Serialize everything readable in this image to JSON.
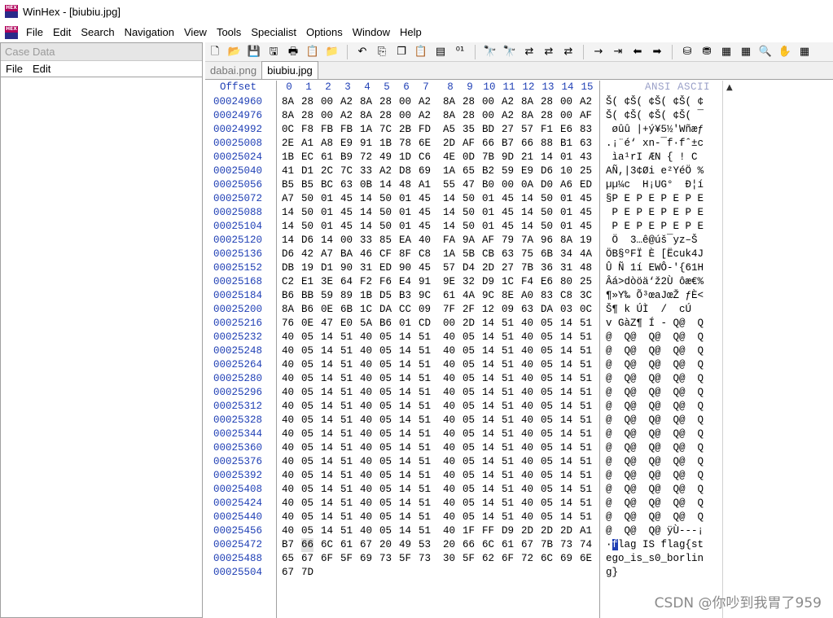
{
  "window": {
    "title": "WinHex - [biubiu.jpg]",
    "app_icon_text": "HEX"
  },
  "menu": [
    "File",
    "Edit",
    "Search",
    "Navigation",
    "View",
    "Tools",
    "Specialist",
    "Options",
    "Window",
    "Help"
  ],
  "case_panel": {
    "header": "Case Data",
    "menu": [
      "File",
      "Edit"
    ]
  },
  "tabs": [
    {
      "label": "dabai.png",
      "active": false
    },
    {
      "label": "biubiu.jpg",
      "active": true
    }
  ],
  "toolbar": [
    "new-file-icon",
    "open-file-icon",
    "save-icon",
    "save-all-icon",
    "print-icon",
    "properties-icon",
    "open-disk-icon",
    "sep",
    "undo-icon",
    "copy-icon",
    "copy-block-icon",
    "paste-icon",
    "paste-write-icon",
    "binary-icon",
    "sep",
    "find-text-icon",
    "find-hex-icon",
    "replace-text-icon",
    "replace-hex-icon",
    "replace-hex-2-icon",
    "sep",
    "goto-offset-icon",
    "goto-sector-icon",
    "back-icon",
    "forward-icon",
    "sep",
    "disk-icon",
    "disks-icon",
    "ram-icon",
    "calculator-icon",
    "search-icon",
    "hand-icon",
    "menu-icon"
  ],
  "toolbar_glyphs": {
    "new-file-icon": "🗋",
    "open-file-icon": "📂",
    "save-icon": "💾",
    "save-all-icon": "🖫",
    "print-icon": "🖶",
    "properties-icon": "📋",
    "open-disk-icon": "📁",
    "undo-icon": "↶",
    "copy-icon": "⎘",
    "copy-block-icon": "❐",
    "paste-icon": "📋",
    "paste-write-icon": "▤",
    "binary-icon": "⁰¹",
    "find-text-icon": "🔭",
    "find-hex-icon": "🔭",
    "replace-text-icon": "⇄",
    "replace-hex-icon": "⇄",
    "replace-hex-2-icon": "⇄",
    "goto-offset-icon": "→",
    "goto-sector-icon": "⇥",
    "back-icon": "⬅",
    "forward-icon": "➡",
    "disk-icon": "⛁",
    "disks-icon": "⛃",
    "ram-icon": "▦",
    "calculator-icon": "▦",
    "search-icon": "🔍",
    "hand-icon": "✋",
    "menu-icon": "▦"
  },
  "colors": {
    "offset_blue": "#1f3fb5",
    "cursor_bg": "#1f3fb5",
    "selection_bg": "#e0e0e0"
  },
  "hex_view": {
    "offset_header": "Offset",
    "column_numbers": [
      "0",
      "1",
      "2",
      "3",
      "4",
      "5",
      "6",
      "7",
      "8",
      "9",
      "10",
      "11",
      "12",
      "13",
      "14",
      "15"
    ],
    "ascii_header": "ANSI ASCII",
    "rows": [
      {
        "offset": "00024960",
        "hex": "8A 28 00 A2 8A 28 00 A2  8A 28 00 A2 8A 28 00 A2",
        "ascii": "Š( ¢Š( ¢Š( ¢Š( ¢"
      },
      {
        "offset": "00024976",
        "hex": "8A 28 00 A2 8A 28 00 A2  8A 28 00 A2 8A 28 00 AF",
        "ascii": "Š( ¢Š( ¢Š( ¢Š( ¯"
      },
      {
        "offset": "00024992",
        "hex": "0C F8 FB FB 1A 7C 2B FD  A5 35 BD 27 57 F1 E6 83",
        "ascii": " øûû |+ý¥5½'Wñæƒ"
      },
      {
        "offset": "00025008",
        "hex": "2E A1 A8 E9 91 1B 78 6E  2D AF 66 B7 66 88 B1 63",
        "ascii": ".¡¨é‘ xn-¯f·fˆ±c"
      },
      {
        "offset": "00025024",
        "hex": "1B EC 61 B9 72 49 1D C6  4E 0D 7B 9D 21 14 01 43",
        "ascii": " ìa¹rI ÆN { ! C"
      },
      {
        "offset": "00025040",
        "hex": "41 D1 2C 7C 33 A2 D8 69  1A 65 B2 59 E9 D6 10 25",
        "ascii": "AÑ,|3¢Øi e²YéÖ %"
      },
      {
        "offset": "00025056",
        "hex": "B5 B5 BC 63 0B 14 48 A1  55 47 B0 00 0A D0 A6 ED",
        "ascii": "µµ¼c  H¡UG°  Ð¦í"
      },
      {
        "offset": "00025072",
        "hex": "A7 50 01 45 14 50 01 45  14 50 01 45 14 50 01 45",
        "ascii": "§P E P E P E P E"
      },
      {
        "offset": "00025088",
        "hex": "14 50 01 45 14 50 01 45  14 50 01 45 14 50 01 45",
        "ascii": " P E P E P E P E"
      },
      {
        "offset": "00025104",
        "hex": "14 50 01 45 14 50 01 45  14 50 01 45 14 50 01 45",
        "ascii": " P E P E P E P E"
      },
      {
        "offset": "00025120",
        "hex": "14 D6 14 00 33 85 EA 40  FA 9A AF 79 7A 96 8A 19",
        "ascii": " Ö  3…ê@úš¯yz–Š "
      },
      {
        "offset": "00025136",
        "hex": "D6 42 A7 BA 46 CF 8F C8  1A 5B CB 63 75 6B 34 4A",
        "ascii": "ÖB§ºFÏ È [Ëcuk4J"
      },
      {
        "offset": "00025152",
        "hex": "DB 19 D1 90 31 ED 90 45  57 D4 2D 27 7B 36 31 48",
        "ascii": "Û Ñ 1í EWÔ-'{61H"
      },
      {
        "offset": "00025168",
        "hex": "C2 E1 3E 64 F2 F6 E4 91  9E 32 D9 1C F4 E6 80 25",
        "ascii": "Âá>dòöä‘ž2Ù ôæ€%"
      },
      {
        "offset": "00025184",
        "hex": "B6 BB 59 89 1B D5 B3 9C  61 4A 9C 8E A0 83 C8 3C",
        "ascii": "¶»Y‰ Õ³œaJœŽ ƒÈ<"
      },
      {
        "offset": "00025200",
        "hex": "8A B6 0E 6B 1C DA CC 09  7F 2F 12 09 63 DA 03 0C",
        "ascii": "Š¶ k ÚÌ  /  cÚ  "
      },
      {
        "offset": "00025216",
        "hex": "76 0E 47 E0 5A B6 01 CD  00 2D 14 51 40 05 14 51",
        "ascii": "v GàZ¶ Í - Q@  Q"
      },
      {
        "offset": "00025232",
        "hex": "40 05 14 51 40 05 14 51  40 05 14 51 40 05 14 51",
        "ascii": "@  Q@  Q@  Q@  Q"
      },
      {
        "offset": "00025248",
        "hex": "40 05 14 51 40 05 14 51  40 05 14 51 40 05 14 51",
        "ascii": "@  Q@  Q@  Q@  Q"
      },
      {
        "offset": "00025264",
        "hex": "40 05 14 51 40 05 14 51  40 05 14 51 40 05 14 51",
        "ascii": "@  Q@  Q@  Q@  Q"
      },
      {
        "offset": "00025280",
        "hex": "40 05 14 51 40 05 14 51  40 05 14 51 40 05 14 51",
        "ascii": "@  Q@  Q@  Q@  Q"
      },
      {
        "offset": "00025296",
        "hex": "40 05 14 51 40 05 14 51  40 05 14 51 40 05 14 51",
        "ascii": "@  Q@  Q@  Q@  Q"
      },
      {
        "offset": "00025312",
        "hex": "40 05 14 51 40 05 14 51  40 05 14 51 40 05 14 51",
        "ascii": "@  Q@  Q@  Q@  Q"
      },
      {
        "offset": "00025328",
        "hex": "40 05 14 51 40 05 14 51  40 05 14 51 40 05 14 51",
        "ascii": "@  Q@  Q@  Q@  Q"
      },
      {
        "offset": "00025344",
        "hex": "40 05 14 51 40 05 14 51  40 05 14 51 40 05 14 51",
        "ascii": "@  Q@  Q@  Q@  Q"
      },
      {
        "offset": "00025360",
        "hex": "40 05 14 51 40 05 14 51  40 05 14 51 40 05 14 51",
        "ascii": "@  Q@  Q@  Q@  Q"
      },
      {
        "offset": "00025376",
        "hex": "40 05 14 51 40 05 14 51  40 05 14 51 40 05 14 51",
        "ascii": "@  Q@  Q@  Q@  Q"
      },
      {
        "offset": "00025392",
        "hex": "40 05 14 51 40 05 14 51  40 05 14 51 40 05 14 51",
        "ascii": "@  Q@  Q@  Q@  Q"
      },
      {
        "offset": "00025408",
        "hex": "40 05 14 51 40 05 14 51  40 05 14 51 40 05 14 51",
        "ascii": "@  Q@  Q@  Q@  Q"
      },
      {
        "offset": "00025424",
        "hex": "40 05 14 51 40 05 14 51  40 05 14 51 40 05 14 51",
        "ascii": "@  Q@  Q@  Q@  Q"
      },
      {
        "offset": "00025440",
        "hex": "40 05 14 51 40 05 14 51  40 05 14 51 40 05 14 51",
        "ascii": "@  Q@  Q@  Q@  Q"
      },
      {
        "offset": "00025456",
        "hex": "40 05 14 51 40 05 14 51  40 1F FF D9 2D 2D 2D A1",
        "ascii": "@  Q@  Q@ ÿÙ---¡"
      },
      {
        "offset": "00025472",
        "hex": "B7 66 6C 61 67 20 49 53  20 66 6C 61 67 7B 73 74",
        "ascii": "·flag IS flag{st"
      },
      {
        "offset": "00025488",
        "hex": "65 67 6F 5F 69 73 5F 73  30 5F 62 6F 72 6C 69 6E",
        "ascii": "ego_is_s0_borlin"
      },
      {
        "offset": "00025504",
        "hex": "67 7D",
        "ascii": "g}"
      }
    ]
  },
  "watermark": "CSDN @你吵到我胃了959"
}
